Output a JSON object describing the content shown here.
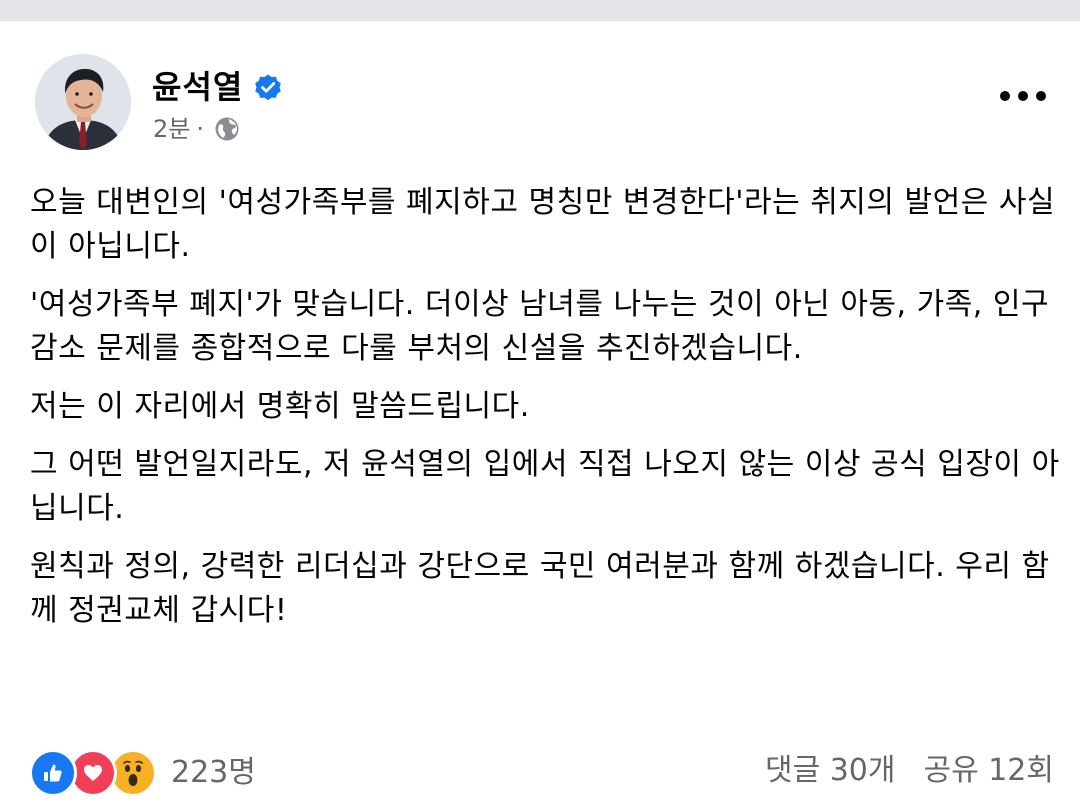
{
  "post": {
    "author": "윤석열",
    "timestamp": "2분",
    "separator": "·",
    "privacy_icon": "globe-icon",
    "verified_icon": "verified-badge-icon",
    "more_icon": "more-options-icon",
    "paragraphs": [
      "오늘 대변인의 '여성가족부를 폐지하고 명칭만 변경한다'라는 취지의 발언은 사실이 아닙니다.",
      "'여성가족부 폐지'가 맞습니다. 더이상 남녀를 나누는 것이 아닌 아동, 가족, 인구감소 문제를 종합적으로 다룰 부처의 신설을 추진하겠습니다.",
      "저는 이 자리에서 명확히 말씀드립니다.",
      "그 어떤 발언일지라도, 저 윤석열의 입에서 직접 나오지 않는 이상 공식 입장이 아닙니다.",
      "원칙과 정의, 강력한 리더십과 강단으로 국민 여러분과 함께 하겠습니다. 우리 함께 정권교체 갑시다!"
    ],
    "reactions": {
      "icons": [
        "like-icon",
        "love-icon",
        "wow-icon"
      ],
      "count": "223명"
    },
    "comments": "댓글 30개",
    "shares": "공유 12회"
  },
  "colors": {
    "brand_blue": "#1877f2",
    "love_red": "#f33e58",
    "wow_yellow": "#f7b125",
    "secondary_text": "#65676b"
  }
}
